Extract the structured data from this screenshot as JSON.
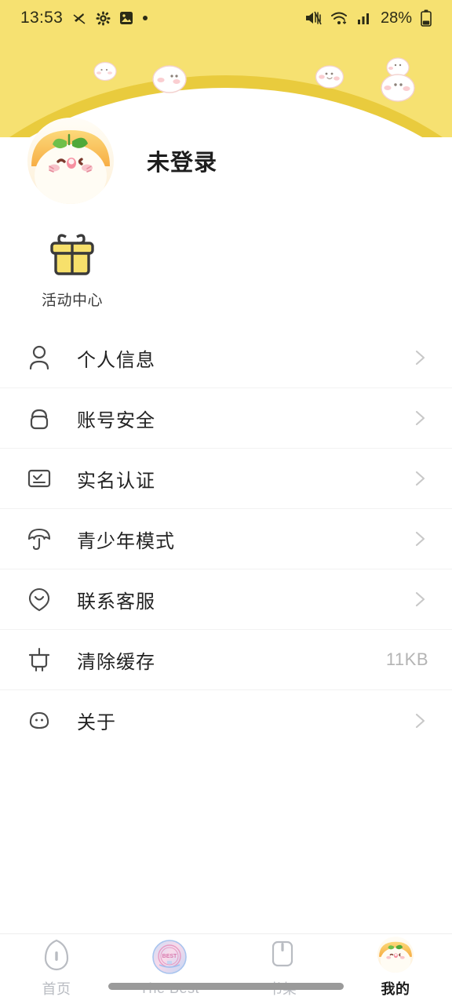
{
  "status_bar": {
    "time": "13:53",
    "battery_percent": "28%",
    "icons": [
      "mute-icon",
      "gear-icon",
      "image-icon",
      "dot-icon",
      "wifi-icon",
      "signal-icon",
      "battery-icon"
    ]
  },
  "header": {
    "background_color": "#F6E171",
    "arc_color": "#E9CB3D",
    "decorations": [
      "mochi-small",
      "mochi-medium",
      "mochi-small-right",
      "mochi-stacked"
    ]
  },
  "profile": {
    "nickname": "未登录",
    "avatar_name": "user-avatar-mascot"
  },
  "activity": {
    "label": "活动中心",
    "icon": "gift-icon",
    "icon_color": "#F5DF5E"
  },
  "menu": {
    "items": [
      {
        "label": "个人信息",
        "icon": "person-icon",
        "value": "",
        "chevron": true
      },
      {
        "label": "账号安全",
        "icon": "lock-icon",
        "value": "",
        "chevron": true
      },
      {
        "label": "实名认证",
        "icon": "id-card-icon",
        "value": "",
        "chevron": true
      },
      {
        "label": "青少年模式",
        "icon": "umbrella-icon",
        "value": "",
        "chevron": true
      },
      {
        "label": "联系客服",
        "icon": "support-icon",
        "value": "",
        "chevron": true
      },
      {
        "label": "清除缓存",
        "icon": "broom-icon",
        "value": "11KB",
        "chevron": false
      },
      {
        "label": "关于",
        "icon": "info-face-icon",
        "value": "",
        "chevron": true
      }
    ]
  },
  "tabbar": {
    "tabs": [
      {
        "label": "首页",
        "icon": "home-icon",
        "active": false
      },
      {
        "label": "The Best",
        "icon": "best-badge-icon",
        "active": false
      },
      {
        "label": "书架",
        "icon": "bookshelf-icon",
        "active": false
      },
      {
        "label": "我的",
        "icon": "profile-avatar-icon",
        "active": true
      }
    ]
  }
}
